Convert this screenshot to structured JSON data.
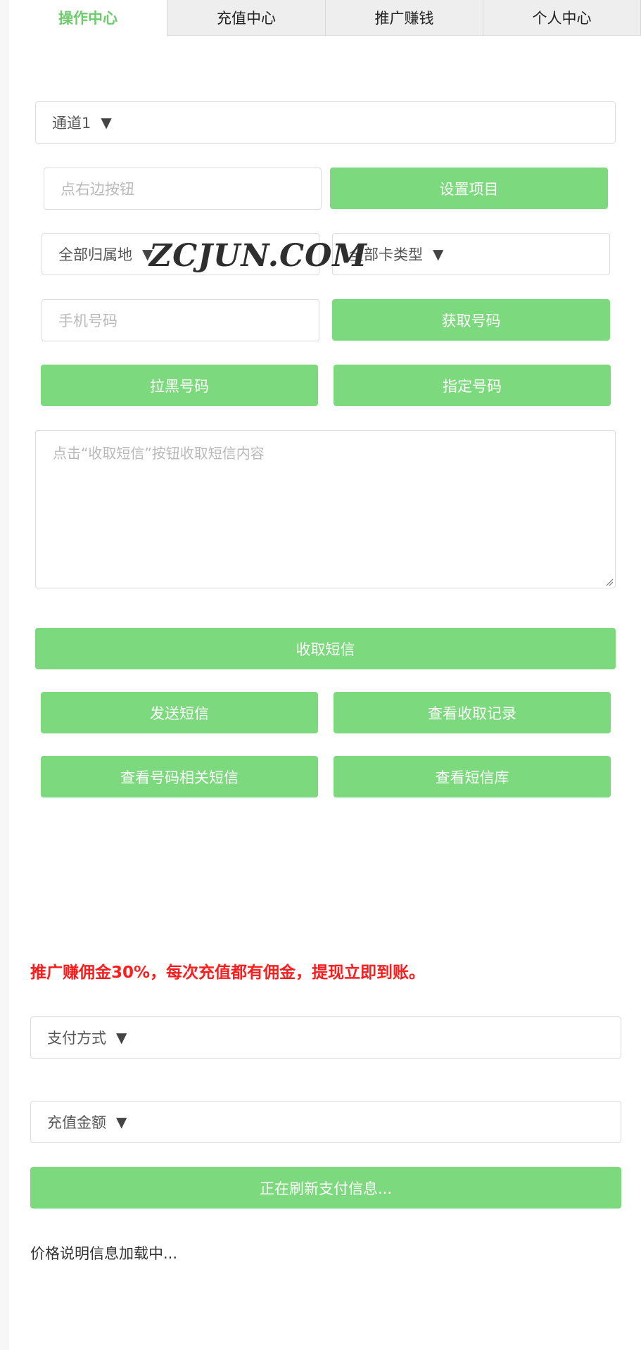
{
  "tabs": [
    "操作中心",
    "充值中心",
    "推广赚钱",
    "个人中心"
  ],
  "channel_select": {
    "value": "通道1",
    "arrow": "▼"
  },
  "project": {
    "placeholder": "点右边按钮",
    "button": "设置项目"
  },
  "region_select": {
    "value": "全部归属地",
    "arrow": "▼"
  },
  "card_type_select": {
    "value": "全部卡类型",
    "arrow": "▼"
  },
  "phone": {
    "placeholder": "手机号码",
    "button": "获取号码"
  },
  "buttons_row1": {
    "blacklist": "拉黑号码",
    "assign": "指定号码"
  },
  "sms_textarea": {
    "placeholder": "点击“收取短信”按钮收取短信内容"
  },
  "receive_sms_button": "收取短信",
  "buttons_row2": {
    "send_sms": "发送短信",
    "view_records": "查看收取记录"
  },
  "buttons_row3": {
    "view_related": "查看号码相关短信",
    "view_library": "查看短信库"
  },
  "watermark": "ZCJUN.COM",
  "promo_text": "推广赚佣金30%，每次充值都有佣金，提现立即到账。",
  "payment_select": {
    "value": "支付方式",
    "arrow": "▼"
  },
  "amount_select": {
    "value": "充值金额",
    "arrow": "▼"
  },
  "refresh_button": "正在刷新支付信息...",
  "price_info": "价格说明信息加载中...",
  "colors": {
    "accent": "#7dd97d",
    "active_tab": "#6ccc6c",
    "promo": "#ff1c1c"
  }
}
